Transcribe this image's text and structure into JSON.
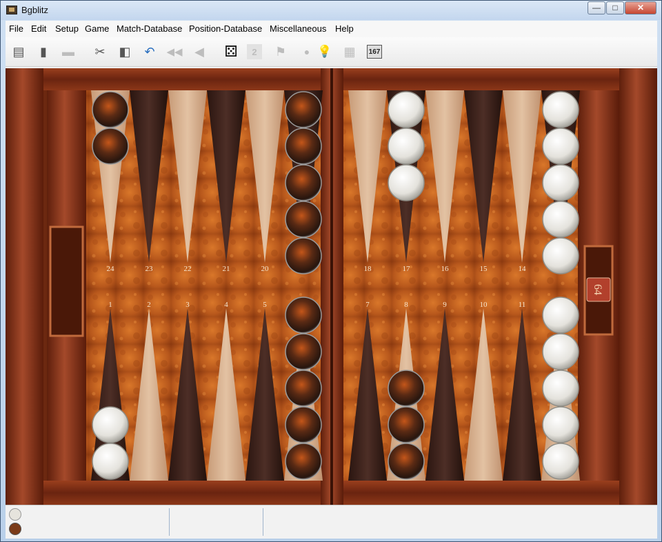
{
  "window": {
    "title": "Bgblitz"
  },
  "window_controls": {
    "minimize": "—",
    "maximize": "□",
    "close": "✕"
  },
  "menu": [
    "File",
    "Edit",
    "Setup",
    "Game",
    "Match-Database",
    "Position-Database",
    "Miscellaneous",
    "Help"
  ],
  "toolbar": [
    {
      "name": "new-icon",
      "glyph": "▤",
      "enabled": true
    },
    {
      "name": "open-icon",
      "glyph": "▮",
      "enabled": true
    },
    {
      "name": "save-icon",
      "glyph": "▬",
      "enabled": false
    },
    {
      "name": "settings-icon",
      "glyph": "✂",
      "enabled": true
    },
    {
      "name": "flip-board-icon",
      "glyph": "◧",
      "enabled": true
    },
    {
      "name": "undo-icon",
      "glyph": "↶",
      "enabled": true
    },
    {
      "name": "rewind-icon",
      "glyph": "◀◀",
      "enabled": false
    },
    {
      "name": "step-back-icon",
      "glyph": "◀",
      "enabled": false
    },
    {
      "name": "roll-dice-icon",
      "glyph": "⚄",
      "enabled": true
    },
    {
      "name": "double-icon",
      "glyph": "2",
      "enabled": false
    },
    {
      "name": "resign-flag-icon",
      "glyph": "⚑",
      "enabled": false
    },
    {
      "name": "stop-icon",
      "glyph": "●",
      "enabled": false
    },
    {
      "name": "hint-bulb-icon",
      "glyph": "💡",
      "enabled": true
    },
    {
      "name": "panels-icon",
      "glyph": "▦",
      "enabled": false
    },
    {
      "name": "pip-count-icon",
      "glyph": "167",
      "enabled": true
    }
  ],
  "board": {
    "top_points_left": [
      "24",
      "23",
      "22",
      "21",
      "20"
    ],
    "top_points_right": [
      "18",
      "17",
      "16",
      "15",
      "14"
    ],
    "bottom_points_left": [
      "1",
      "2",
      "3",
      "4",
      "5"
    ],
    "bottom_points_right": [
      "7",
      "8",
      "9",
      "10",
      "11"
    ],
    "cube_value": "64",
    "checkers": {
      "white": {
        "p13": 5,
        "p17": 3,
        "p12": 5,
        "p1": 2
      },
      "dark": {
        "p24": 2,
        "p19": 5,
        "p6": 5,
        "p8": 3
      }
    }
  },
  "status": {
    "player_white_color": "#e6e4dd",
    "player_dark_color": "#7a3a18"
  }
}
